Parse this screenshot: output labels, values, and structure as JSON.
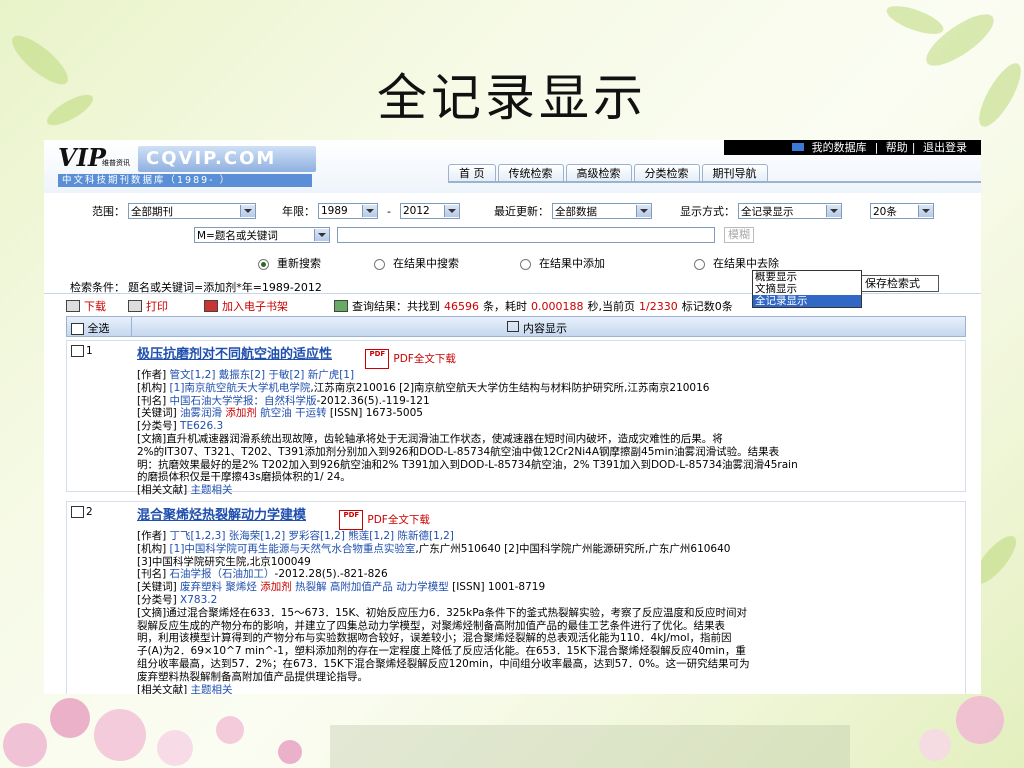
{
  "slide": {
    "title": "全记录显示"
  },
  "header": {
    "logo_text": "VIP",
    "logo_small": "维普资讯",
    "logo_cqvip": "CQVIP.COM",
    "logo_sub": "中文科技期刊数据库（1989- ）",
    "toplinks": [
      "我的数据库",
      "帮助",
      "退出登录"
    ],
    "nav_tabs": [
      "首  页",
      "传统检索",
      "高级检索",
      "分类检索",
      "期刊导航"
    ]
  },
  "form": {
    "range_label": "范围：",
    "range_value": "全部期刊",
    "year_label": "年限：",
    "year_from": "1989",
    "year_sep": "-",
    "year_to": "2012",
    "update_label": "最近更新：",
    "update_value": "全部数据",
    "display_label": "显示方式：",
    "display_value": "全记录显示",
    "per_page_value": "20条",
    "field_value": "M=题名或关键词",
    "search_btn_partial": "模糊",
    "display_options": [
      "概要显示",
      "文摘显示",
      "全记录显示"
    ],
    "radios": [
      "重新搜索",
      "在结果中搜索",
      "在结果中添加",
      "在结果中去除"
    ],
    "condition_label": "检索条件：",
    "condition_value": "题名或关键词=添加剂*年=1989-2012",
    "save_btn": "保存检索式"
  },
  "toolbar": {
    "download": "下载",
    "print": "打印",
    "ebook": "加入电子书架",
    "result_prefix": "查询结果：共找到",
    "total": "46596",
    "count_unit": "条，耗时",
    "time": "0.000188",
    "time_unit": "秒,当前页",
    "page": "1/2330",
    "per_page": "标记数0条"
  },
  "table_header": {
    "select_all": "全选",
    "content": "内容显示"
  },
  "records": [
    {
      "num": "1",
      "title": "极压抗磨剂对不同航空油的适应性",
      "pdf": "PDF全文下载",
      "author_label": "[作者]",
      "authors": "管文[1,2]  戴振东[2]  于敏[2]  新广虎[1]",
      "org_label": "[机构]",
      "org": "[1]南京航空航天大学机电学院",
      "org_rest": ",江苏南京210016  [2]南京航空航天大学仿生结构与材料防护研究所,江苏南京210016",
      "journal_label": "[刊名]",
      "journal": "中国石油大学学报：自然科学版",
      "journal_rest": "-2012.36(5).-119-121",
      "kw_label": "[关键词]",
      "kw1": "油雾润滑",
      "kw2": "添加剂",
      "kw3": "航空油",
      "kw4": "干运转",
      "issn": "[ISSN] 1673-5005",
      "cls_label": "[分类号]",
      "cls": "TE626.3",
      "abs_label": "[文摘]",
      "abs_lines": [
        "直升机减速器润滑系统出现故障，齿轮轴承将处于无润滑油工作状态，使减速器在短时间内破坏，造成灾难性的后果。将",
        "2%的IT307、T321、T202、T391添加剂分别加入到926和DOD-L-85734航空油中做12Cr2Ni4A钢摩擦副45min油雾润滑试验。结果表",
        "明：抗磨效果最好的是2% T202加入到926航空油和2% T391加入到DOD-L-85734航空油，2% T391加入到DOD-L-85734油雾润滑45rain",
        "的磨损体积仅是干摩擦43s磨损体积的1/ 24。"
      ],
      "rel_label": "[相关文献]",
      "rel": "主题相关"
    },
    {
      "num": "2",
      "title": "混合聚烯烃热裂解动力学建模",
      "pdf": "PDF全文下载",
      "author_label": "[作者]",
      "authors": "丁飞[1,2,3]  张海荣[1,2]  罗彩容[1,2]  熊莲[1,2]  陈新德[1,2]",
      "org_label": "[机构]",
      "org": "[1]中国科学院可再生能源与天然气水合物重点实验室",
      "org_rest": ",广东广州510640  [2]中国科学院广州能源研究所,广东广州610640",
      "org_line2": "[3]中国科学院研究生院,北京100049",
      "journal_label": "[刊名]",
      "journal": "石油学报（石油加工）",
      "journal_rest": "-2012.28(5).-821-826",
      "kw_label": "[关键词]",
      "kw1": "废弃塑料",
      "kw2": "聚烯烃",
      "kw3": "添加剂",
      "kw4": "热裂解",
      "kw5": "高附加值产品",
      "kw6": "动力学模型",
      "issn": "[ISSN] 1001-8719",
      "cls_label": "[分类号]",
      "cls": "X783.2",
      "abs_label": "[文摘]",
      "abs_lines": [
        "通过混合聚烯烃在633．15～673．15K、初始反应压力6．325kPa条件下的釜式热裂解实验，考察了反应温度和反应时间对",
        "裂解反应生成的产物分布的影响，并建立了四集总动力学模型，对聚烯烃制备高附加值产品的最佳工艺条件进行了优化。结果表",
        "明，利用该模型计算得到的产物分布与实验数据吻合较好，误差较小；混合聚烯烃裂解的总表观活化能为110．4kJ/mol，指前因",
        "子(A)为2．69×10^7 min^-1，塑料添加剂的存在一定程度上降低了反应活化能。在653．15K下混合聚烯烃裂解反应40min，重",
        "组分收率最高，达到57．2%；在673．15K下混合聚烯烃裂解反应120min，中间组分收率最高，达到57．0%。这一研究结果可为",
        "废弃塑料热裂解制备高附加值产品提供理论指导。"
      ],
      "rel_label": "[相关文献]",
      "rel": "主题相关"
    }
  ]
}
